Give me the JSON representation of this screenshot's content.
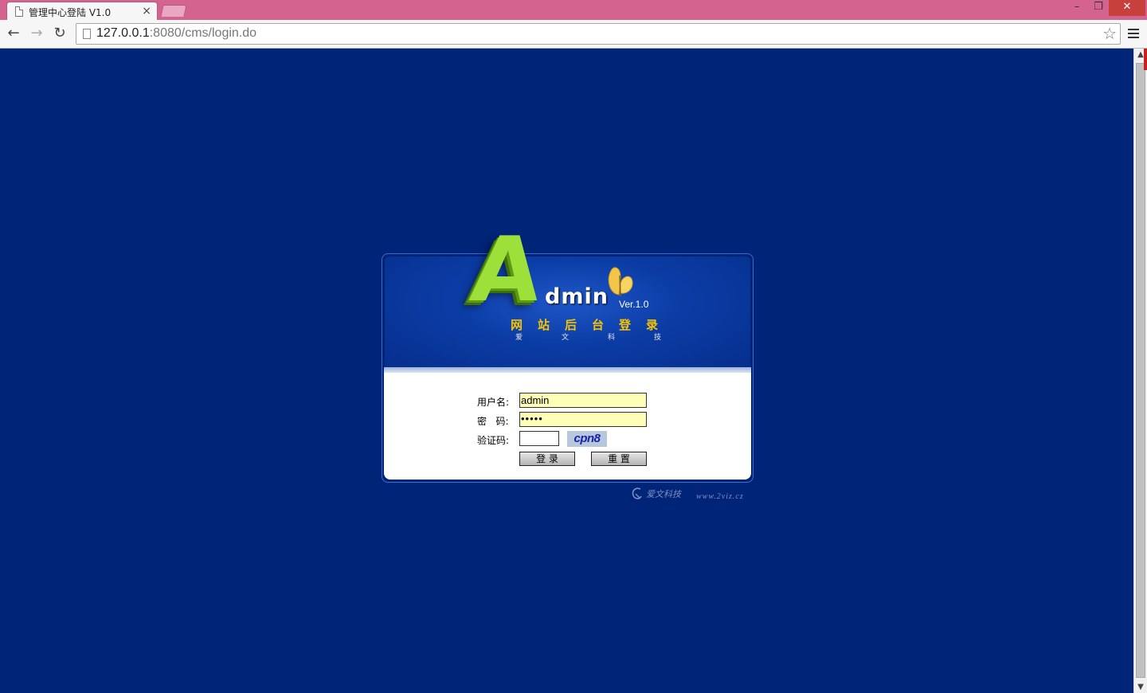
{
  "browser": {
    "tab_title": "管理中心登陆 V1.0",
    "tab_close": "×",
    "window_min": "–",
    "window_max": "❐",
    "window_close": "✕",
    "nav_back": "←",
    "nav_forward": "→",
    "nav_reload": "↻",
    "url_host": "127.0.0.1",
    "url_rest": ":8080/cms/login.do",
    "star": "☆",
    "scroll_up": "▲",
    "scroll_down": "▼"
  },
  "banner": {
    "logo_letter": "A",
    "logo_rest": "dmin",
    "version": "Ver.1.0",
    "subtitle_chars": [
      "网",
      "站",
      "后",
      "台",
      "登",
      "录"
    ],
    "company_chars": [
      "爱",
      "文",
      "科",
      "技"
    ]
  },
  "form": {
    "username_label": "用户名:",
    "password_label": "密   码:",
    "captcha_label": "验证码:",
    "username_value": "admin",
    "password_value": "•••••",
    "captcha_value": "",
    "captcha_image_text": "cpn8",
    "login_button": "登 录",
    "reset_button": "重 置"
  },
  "footer": {
    "logo_text": "爱文科技",
    "url": "www.2viz.cz"
  },
  "colors": {
    "page_background": "#002478",
    "titlebar": "#d4638f",
    "logo_green": "#9ee03a",
    "subtitle_gold": "#f5c400",
    "input_highlight": "#ffffb8"
  }
}
